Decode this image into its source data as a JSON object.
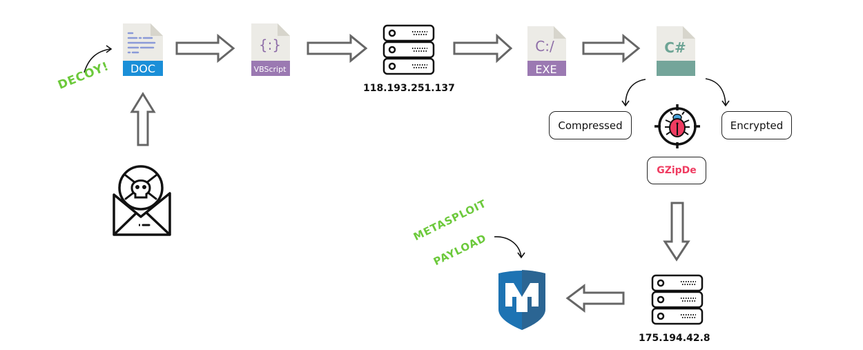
{
  "diagram": {
    "title": "",
    "nodes": {
      "email": {
        "icon": "malicious-email-icon"
      },
      "doc": {
        "tag": "DOC",
        "icon": "doc-file-icon",
        "color": "#1a8fd8"
      },
      "vbscript": {
        "tag": "VBScript",
        "glyph": "{:}",
        "icon": "vbscript-file-icon",
        "color": "#9b79b2"
      },
      "server1": {
        "ip": "118.193.251.137",
        "icon": "server-icon"
      },
      "exe": {
        "tag": "EXE",
        "glyph": "C:/",
        "icon": "exe-file-icon",
        "color": "#9b79b2"
      },
      "csharp": {
        "tag": "",
        "glyph": "C#",
        "icon": "csharp-file-icon",
        "color": "#74a59a"
      },
      "compressed": {
        "label": "Compressed"
      },
      "encrypted": {
        "label": "Encrypted"
      },
      "malware": {
        "label": "GZipDe",
        "icon": "bug-target-icon",
        "color": "#ef3c61"
      },
      "server2": {
        "ip": "175.194.42.8",
        "icon": "server-icon"
      },
      "metasploit": {
        "icon": "metasploit-shield-icon"
      }
    },
    "annotations": {
      "decoy": "DECOY!",
      "metasploit_line1": "METASPLOIT",
      "metasploit_line2": "PAYLOAD"
    },
    "edges": [
      {
        "from": "email",
        "to": "doc"
      },
      {
        "from": "doc",
        "to": "vbscript"
      },
      {
        "from": "vbscript",
        "to": "server1"
      },
      {
        "from": "server1",
        "to": "exe"
      },
      {
        "from": "exe",
        "to": "csharp"
      },
      {
        "from": "csharp",
        "to": "compressed"
      },
      {
        "from": "csharp",
        "to": "encrypted"
      },
      {
        "from": "malware",
        "to": "server2"
      },
      {
        "from": "server2",
        "to": "metasploit"
      }
    ]
  }
}
